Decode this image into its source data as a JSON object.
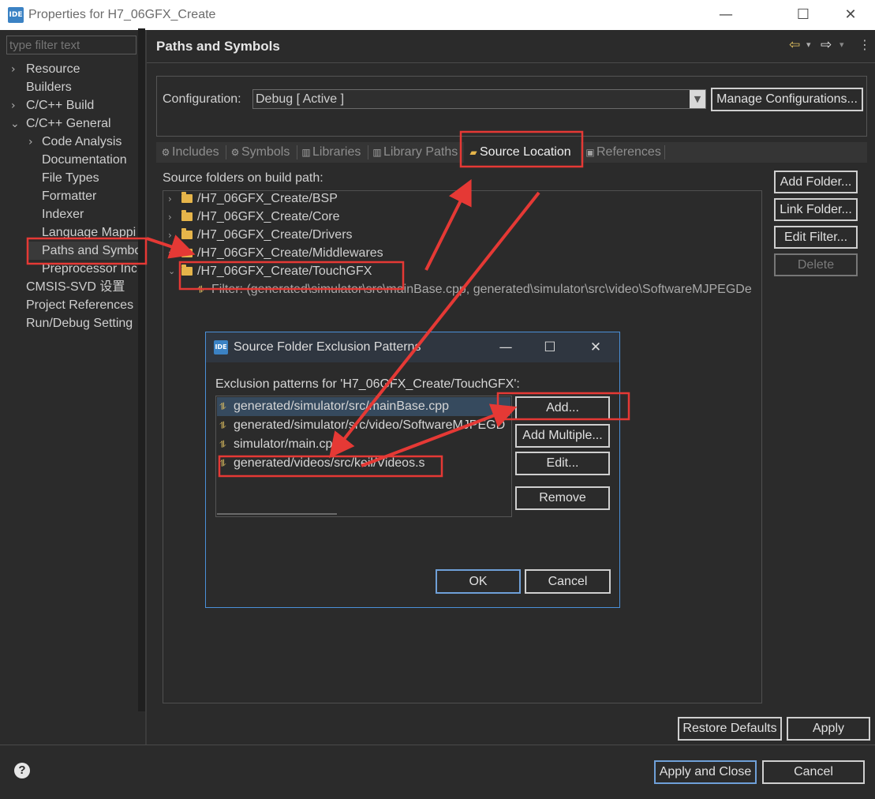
{
  "window": {
    "logo": "IDE",
    "title": "Properties for H7_06GFX_Create",
    "minimize": "—",
    "maximize": "☐",
    "close": "✕"
  },
  "nav": {
    "filter_placeholder": "type filter text",
    "items": [
      {
        "label": "Resource"
      },
      {
        "label": "Builders"
      },
      {
        "label": "C/C++ Build"
      },
      {
        "label": "C/C++ General"
      },
      {
        "label": "Code Analysis"
      },
      {
        "label": "Documentation"
      },
      {
        "label": "File Types"
      },
      {
        "label": "Formatter"
      },
      {
        "label": "Indexer"
      },
      {
        "label": "Language Mappi"
      },
      {
        "label": "Paths and Symbo"
      },
      {
        "label": "Preprocessor Inc"
      },
      {
        "label": "CMSIS-SVD 设置"
      },
      {
        "label": "Project References"
      },
      {
        "label": "Run/Debug Setting"
      }
    ]
  },
  "page": {
    "title": "Paths and Symbols"
  },
  "config": {
    "label": "Configuration:",
    "value": "Debug  [ Active ]",
    "manage_button": "Manage Configurations..."
  },
  "tabs": [
    {
      "label": "Includes"
    },
    {
      "label": "Symbols"
    },
    {
      "label": "Libraries"
    },
    {
      "label": "Library Paths"
    },
    {
      "label": "Source Location"
    },
    {
      "label": "References"
    }
  ],
  "source": {
    "label": "Source folders on build path:",
    "folders": [
      "/H7_06GFX_Create/BSP",
      "/H7_06GFX_Create/Core",
      "/H7_06GFX_Create/Drivers",
      "/H7_06GFX_Create/Middlewares",
      "/H7_06GFX_Create/TouchGFX"
    ],
    "filter_row": "Filter: (generated\\simulator\\src\\mainBase.cpp, generated\\simulator\\src\\video\\SoftwareMJPEGDe",
    "buttons": {
      "add_folder": "Add Folder...",
      "link_folder": "Link Folder...",
      "edit_filter": "Edit Filter...",
      "delete": "Delete"
    }
  },
  "footer": {
    "restore_defaults": "Restore Defaults",
    "apply": "Apply",
    "apply_close": "Apply and Close",
    "cancel": "Cancel",
    "help": "?"
  },
  "dialog": {
    "logo": "IDE",
    "title": "Source Folder Exclusion Patterns",
    "label": "Exclusion patterns for 'H7_06GFX_Create/TouchGFX':",
    "patterns": [
      "generated/simulator/src/mainBase.cpp",
      "generated/simulator/src/video/SoftwareMJPEGD",
      "simulator/main.cpp",
      "generated/videos/src/keil/Videos.s"
    ],
    "buttons": {
      "add": "Add...",
      "add_multiple": "Add Multiple...",
      "edit": "Edit...",
      "remove": "Remove",
      "ok": "OK",
      "cancel": "Cancel"
    }
  },
  "annotation_color": "#e53935",
  "accent_color": "#4a90d9"
}
